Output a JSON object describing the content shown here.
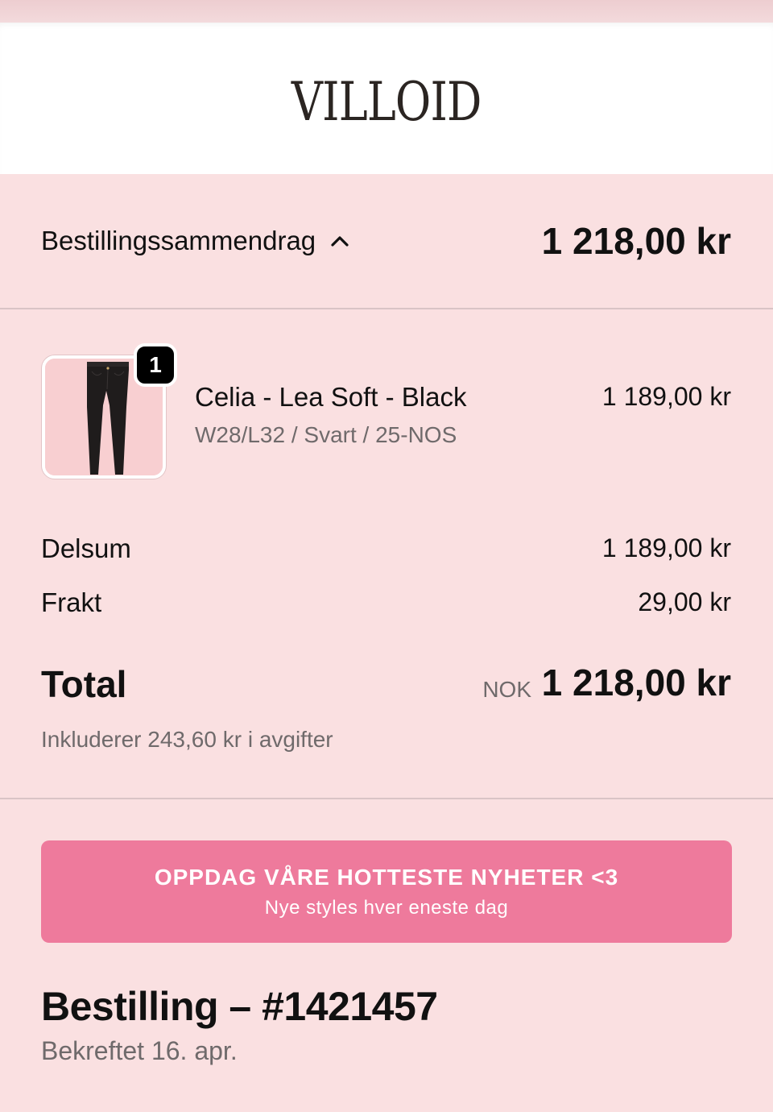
{
  "header": {
    "logo_text": "VILLOID"
  },
  "summary": {
    "toggle_label": "Bestillingssammendrag",
    "toggle_icon": "chevron-up-icon",
    "total": "1 218,00 kr"
  },
  "line_item": {
    "quantity": "1",
    "name": "Celia - Lea Soft - Black",
    "variant": "W28/L32 / Svart / 25-NOS",
    "price": "1 189,00 kr",
    "image_icon": "jeans-product-image"
  },
  "totals": {
    "subtotal_label": "Delsum",
    "subtotal_value": "1 189,00 kr",
    "shipping_label": "Frakt",
    "shipping_value": "29,00 kr",
    "total_label": "Total",
    "currency": "NOK",
    "total_value": "1 218,00 kr",
    "tax_note": "Inkluderer 243,60 kr i avgifter"
  },
  "promo": {
    "title": "OPPDAG VÅRE HOTTESTE NYHETER <3",
    "subtitle": "Nye styles hver eneste dag",
    "color": "#ee7a9c"
  },
  "order": {
    "title": "Bestilling – #1421457",
    "status": "Bekreftet 16. apr."
  },
  "colors": {
    "background": "#fae0e1",
    "header_bg": "#ffffff",
    "badge_bg": "#000000"
  }
}
